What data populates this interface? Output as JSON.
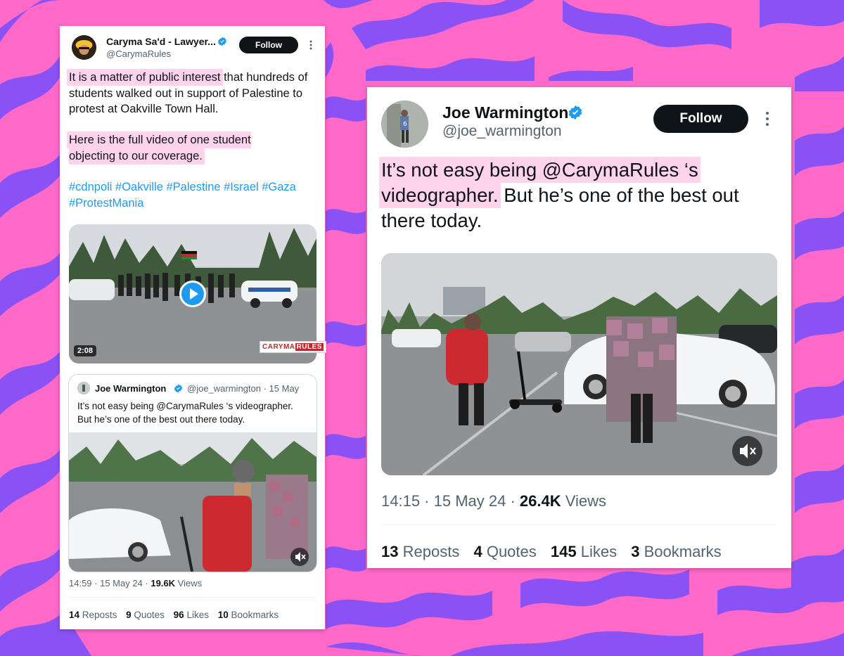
{
  "left_tweet": {
    "author_name": "Caryma Sa'd - Lawyer...",
    "author_handle": "@CarymaRules",
    "follow_label": "Follow",
    "para1_highlight": "It is a matter of public interest",
    "para1_rest": " that hundreds of students walked out in support of Palestine to protest at Oakville Town Hall.",
    "para2_highlight": "Here is the full video of one student objecting to our coverage.",
    "hashtags": "#cdnpoli #Oakville #Palestine #Israel #Gaza #ProtestMania",
    "video_duration": "2:08",
    "watermark_a": "CARYMA",
    "watermark_b": "RULES",
    "quote": {
      "author_name": "Joe Warmington",
      "author_handle": "@joe_warmington",
      "date": "· 15 May",
      "text": "It’s not easy being @CarymaRules ‘s videographer. But he’s one of the best out there today."
    },
    "time": "14:59 · 15 May 24 · ",
    "views_count": "19.6K",
    "views_label": " Views",
    "stats": [
      {
        "count": "14",
        "label": "Reposts"
      },
      {
        "count": "9",
        "label": "Quotes"
      },
      {
        "count": "96",
        "label": "Likes"
      },
      {
        "count": "10",
        "label": "Bookmarks"
      }
    ]
  },
  "right_tweet": {
    "author_name": "Joe Warmington",
    "author_handle": "@joe_warmington",
    "follow_label": "Follow",
    "text_hl_1": "It’s not easy being @CarymaRules ‘s",
    "text_hl_2": "videographer.",
    "text_rest": " But he’s one of the best out there today.",
    "time": "14:15 · 15 May 24 · ",
    "views_count": "26.4K",
    "views_label": " Views",
    "stats": [
      {
        "count": "13",
        "label": "Reposts"
      },
      {
        "count": "4",
        "label": "Quotes"
      },
      {
        "count": "145",
        "label": "Likes"
      },
      {
        "count": "3",
        "label": "Bookmarks"
      }
    ]
  },
  "icons": {
    "verified": "verified-badge-icon",
    "more": "more-options-icon",
    "play": "play-icon",
    "mute": "mute-icon"
  },
  "colors": {
    "background_pink": "#ff69c8",
    "background_purple": "#8a52f5",
    "highlight": "#ffd3ec",
    "link_blue": "#1d9bf0",
    "text_dark": "#0f1419",
    "text_grey": "#536471"
  }
}
